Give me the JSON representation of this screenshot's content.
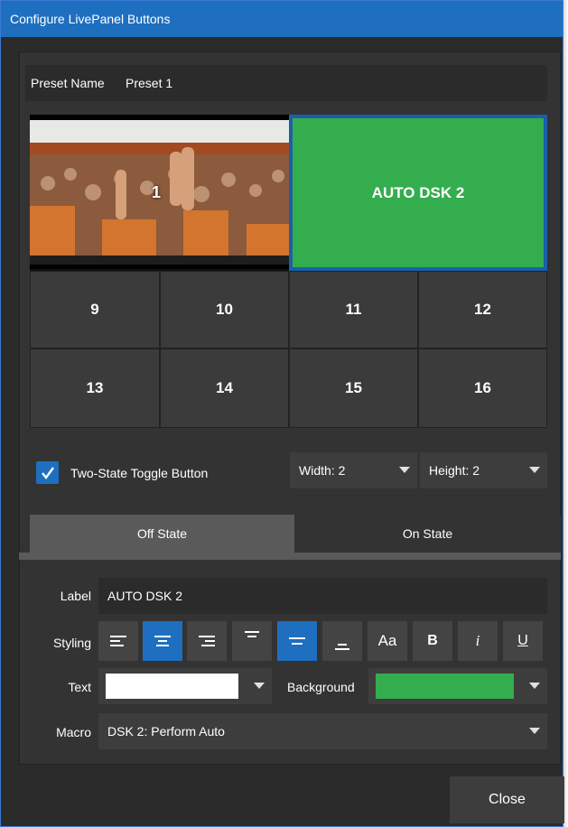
{
  "window": {
    "title": "Configure LivePanel Buttons"
  },
  "preset": {
    "label": "Preset Name",
    "value": "Preset 1"
  },
  "grid": {
    "video_button_number": "1",
    "green_button_label": "AUTO DSK 2",
    "buttons": [
      "9",
      "10",
      "11",
      "12",
      "13",
      "14",
      "15",
      "16"
    ]
  },
  "toggle": {
    "label": "Two-State Toggle Button",
    "checked": true
  },
  "width_select": {
    "value": "Width: 2"
  },
  "height_select": {
    "value": "Height: 2"
  },
  "tabs": {
    "off": "Off State",
    "on": "On State",
    "active": "Off State"
  },
  "form": {
    "label_caption": "Label",
    "label_value": "AUTO DSK 2",
    "styling_caption": "Styling",
    "text_caption": "Text",
    "background_caption": "Background",
    "macro_caption": "Macro",
    "macro_value": "DSK 2: Perform Auto"
  },
  "styling_buttons": {
    "font": "Aa",
    "bold": "B",
    "italic": "i",
    "underline": "U"
  },
  "colors": {
    "text_color": "#ffffff",
    "background_color": "#34ad4f",
    "accent": "#1e6fc0"
  },
  "footer": {
    "close_label": "Close"
  }
}
